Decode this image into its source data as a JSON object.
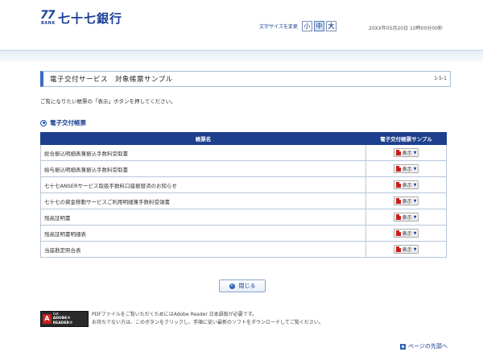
{
  "header": {
    "logo_number": "77",
    "logo_bank": "BANK",
    "logo_name": "七十七銀行",
    "font_size_label": "文字サイズを変更",
    "font_sizes": [
      "小",
      "中",
      "大"
    ],
    "datetime": "20XX年05月20日 10時00分00秒"
  },
  "page": {
    "title": "電子交付サービス　対象帳票サンプル",
    "code": "1-5-1",
    "instruction": "ご覧になりたい帳票の「表示」ボタンを押してください。",
    "section_label": "電子交付帳票"
  },
  "table": {
    "headers": [
      "帳票名",
      "電子交付帳票サンプル"
    ],
    "button_label": "表示",
    "rows": [
      "総合振込明細表兼振込手数料受取書",
      "給与振込明細表兼振込手数料受取書",
      "七十七ANSERサービス取扱手数料口座振替済のお知らせ",
      "七十七の資金移動サービスご利用明細兼手数料受領書",
      "残高証明書",
      "残高証明書明細表",
      "当座勘定照合表"
    ]
  },
  "actions": {
    "close_label": "閉じる"
  },
  "adobe": {
    "get": "Get",
    "reader": "ADOBE® READER®",
    "note_line1": "PDFファイルをご覧いただくためにはAdobe Reader 日本語版が必要です。",
    "note_line2": "お持ちでない方は、このボタンをクリックし、手順に従い最新のソフトをダウンロードしてご覧ください。"
  },
  "footer": {
    "top_link": "ページの先頭へ"
  },
  "colors": {
    "brand": "#1a3f96",
    "table_header": "#1c3f8e",
    "pdf_red": "#c8201e"
  }
}
